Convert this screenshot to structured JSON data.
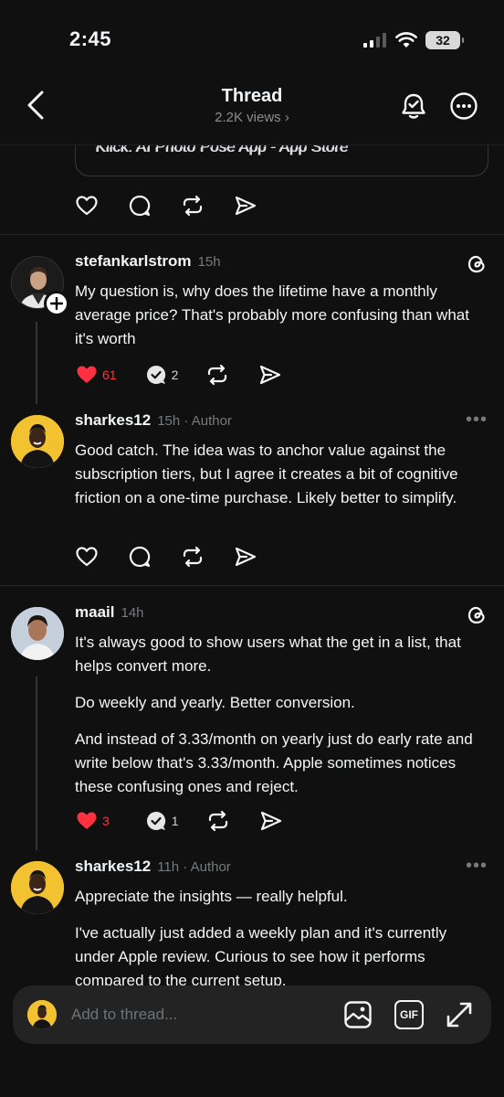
{
  "status": {
    "time": "2:45",
    "battery": "32"
  },
  "header": {
    "title": "Thread",
    "views": "2.2K views ›"
  },
  "quote_card": {
    "text": "Klick: AI Photo Pose App - App Store"
  },
  "posts": [
    {
      "username": "stefankarlstrom",
      "time": "15h",
      "paragraphs": [
        "My question is, why does the lifetime have a monthly average price? That's probably more confusing than what it's worth"
      ],
      "likes": "61",
      "replies": "2",
      "liked": true
    },
    {
      "username": "sharkes12",
      "time": "15h · Author",
      "paragraphs": [
        "Good catch. The idea was to anchor value against the subscription tiers, but I agree it creates a bit of cognitive friction on a one-time purchase. Likely better to simplify."
      ]
    },
    {
      "username": "maail",
      "time": "14h",
      "paragraphs": [
        "It's always good to show users what the get in a list, that helps convert more.",
        "Do weekly and yearly. Better conversion.",
        "And instead of 3.33/month on yearly just do early rate and write below that's 3.33/month. Apple sometimes notices these confusing ones and reject."
      ],
      "likes": "3",
      "replies": "1",
      "liked": true
    },
    {
      "username": "sharkes12",
      "time": "11h · Author",
      "paragraphs": [
        "Appreciate the insights — really helpful.",
        "I've actually just added a weekly plan and it's currently under Apple review. Curious to see how it performs compared to the current setup."
      ]
    }
  ],
  "composer": {
    "placeholder": "Add to thread...",
    "gif_label": "GIF"
  },
  "colors": {
    "background": "#101010",
    "like_red": "#ff3040",
    "text": "#f3f5f7",
    "muted": "#777a7d"
  }
}
